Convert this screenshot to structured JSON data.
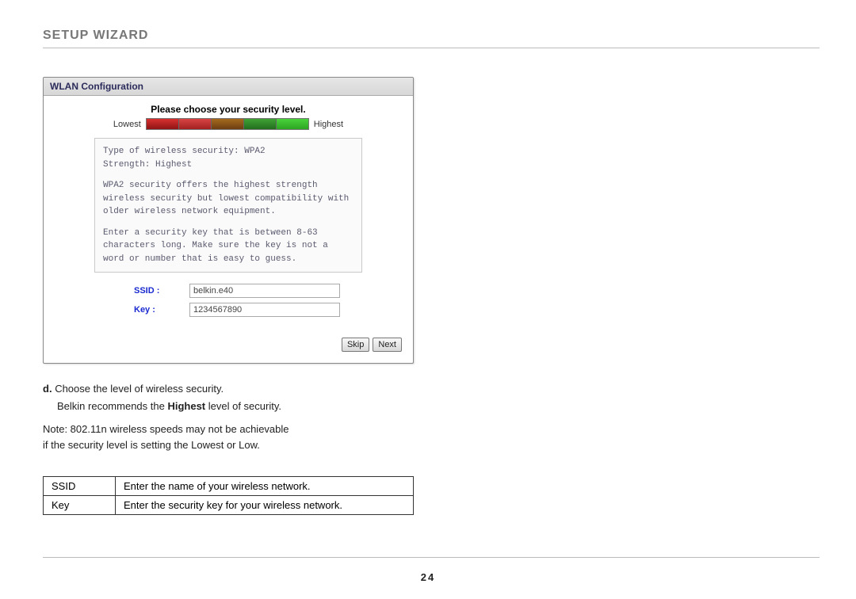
{
  "page_title": "SETUP WIZARD",
  "page_number": "24",
  "wlan": {
    "panel_title": "WLAN Configuration",
    "security_title": "Please choose your security level.",
    "lowest_label": "Lowest",
    "highest_label": "Highest",
    "desc_type": "Type of wireless security: WPA2",
    "desc_strength": "Strength: Highest",
    "desc_para1": "WPA2 security offers the highest strength wireless security but lowest compatibility with older wireless network equipment.",
    "desc_para2": "Enter a security key that is between 8-63 characters long. Make sure the key is not a word or number that is easy to guess.",
    "ssid_label": "SSID :",
    "ssid_value": "belkin.e40",
    "key_label": "Key :",
    "key_value": "1234567890",
    "skip_label": "Skip",
    "next_label": "Next"
  },
  "step": {
    "letter": "d.",
    "line1": "Choose the level of wireless security.",
    "line2a": "Belkin recommends the ",
    "line2_bold": "Highest",
    "line2b": " level of security."
  },
  "note": {
    "line1": "Note: 802.11n wireless speeds may not be achievable",
    "line2": "if the security level is setting the Lowest or Low."
  },
  "table": {
    "r1k": "SSID",
    "r1v": "Enter the name of your wireless network.",
    "r2k": "Key",
    "r2v": "Enter the security key for your wireless network."
  }
}
